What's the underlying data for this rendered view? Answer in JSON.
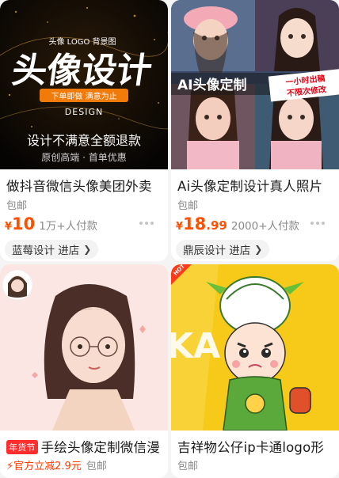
{
  "products": [
    {
      "title": "做抖音微信头像美团外卖",
      "shipping": "包邮",
      "price_int": "10",
      "price_dec": "",
      "sold": "1万+人付款",
      "shop": "蓝莓设计 进店",
      "image": {
        "small_text": "头像 LOGO 背景图",
        "big_text": "头像设计",
        "ribbon": "下单即做 满意为止",
        "design": "DESIGN",
        "line1": "设计不满意全额退款",
        "line2": "原创高端 · 首单优惠"
      }
    },
    {
      "title": "Ai头像定制设计真人照片",
      "shipping": "包邮",
      "price_int": "18",
      "price_dec": ".99",
      "sold": "2000+人付款",
      "shop": "鼎辰设计 进店",
      "image": {
        "banner": "AI头像定制",
        "tag_line1": "一小时出稿",
        "tag_line2": "不限次修改"
      }
    },
    {
      "badge": "年货节",
      "title": "手绘头像定制微信漫",
      "promo": "官方立减2.9元",
      "promo_shipping": "包邮"
    },
    {
      "title": "吉祥物公仔ip卡通logo形",
      "shipping": "包邮",
      "image": {
        "hot": "HOT",
        "bg_text": "KA IG"
      }
    }
  ],
  "colors": {
    "price": "#ff5000",
    "page_bg": "#f4f4f4",
    "card_bg": "#ffffff",
    "badge_bg": "#ff2d2d",
    "yellow": "#f7c919"
  },
  "icons": [
    "more-dots-icon",
    "chevron-right-icon",
    "lightning-icon"
  ]
}
